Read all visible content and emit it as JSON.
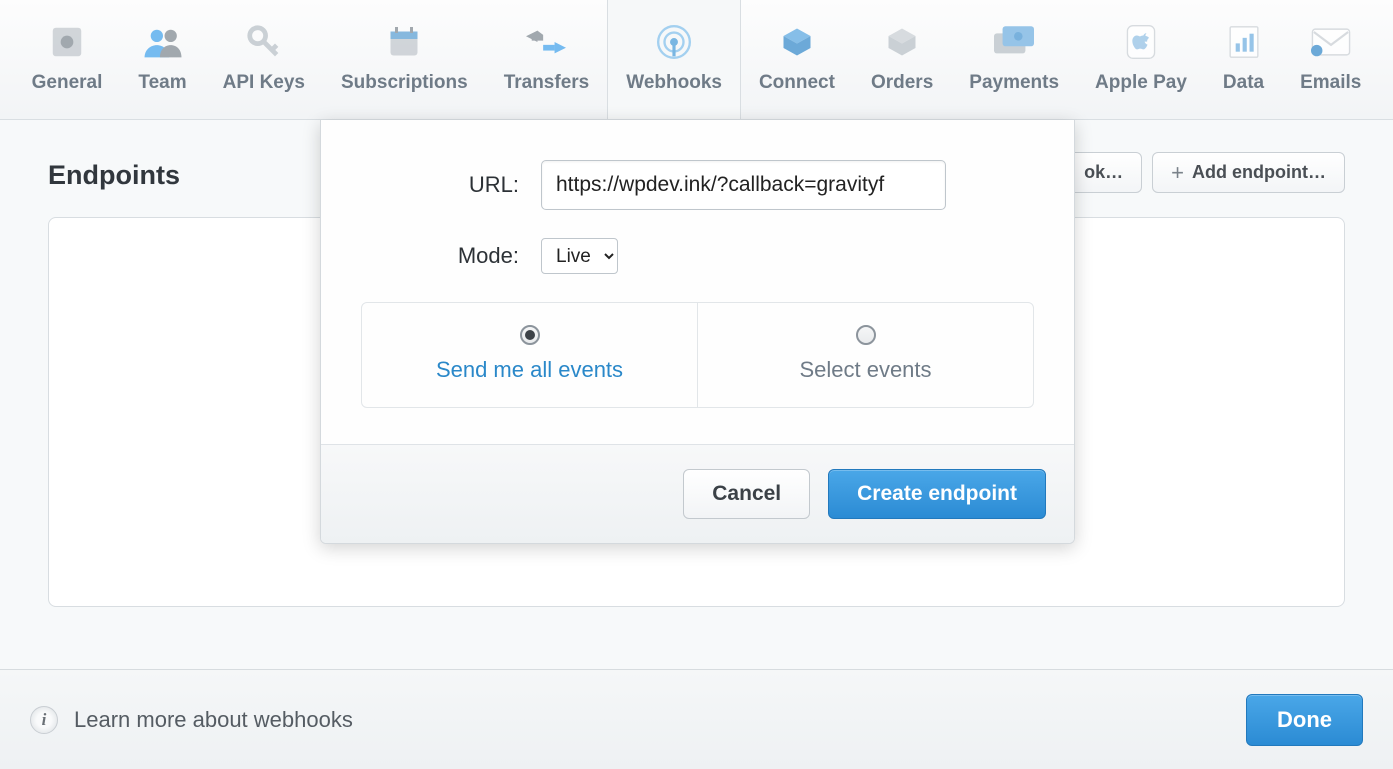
{
  "nav": {
    "tabs": [
      {
        "label": "General"
      },
      {
        "label": "Team"
      },
      {
        "label": "API Keys"
      },
      {
        "label": "Subscriptions"
      },
      {
        "label": "Transfers"
      },
      {
        "label": "Webhooks"
      },
      {
        "label": "Connect"
      },
      {
        "label": "Orders"
      },
      {
        "label": "Payments"
      },
      {
        "label": "Apple Pay"
      },
      {
        "label": "Data"
      },
      {
        "label": "Emails"
      }
    ]
  },
  "page": {
    "heading": "Endpoints",
    "btn_partial": "ok…",
    "btn_add_endpoint": "Add endpoint…"
  },
  "modal": {
    "url_label": "URL:",
    "url_value": "https://wpdev.ink/?callback=gravityf",
    "mode_label": "Mode:",
    "mode_value": "Live",
    "event_all": "Send me all events",
    "event_select": "Select events",
    "cancel": "Cancel",
    "create": "Create endpoint"
  },
  "footer": {
    "learn_more": "Learn more about webhooks",
    "done": "Done"
  }
}
